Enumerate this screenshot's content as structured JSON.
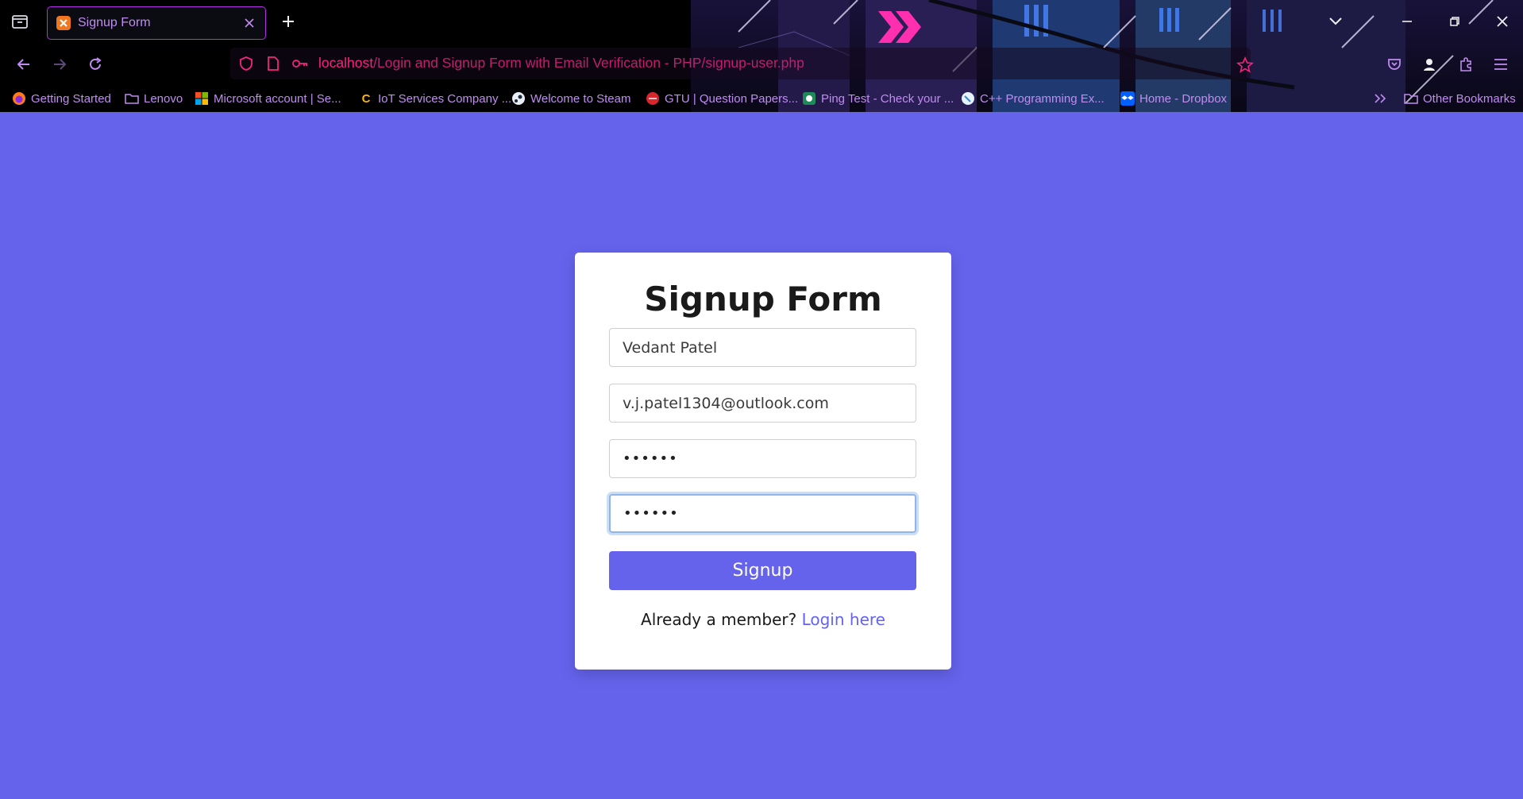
{
  "browser": {
    "tab": {
      "title": "Signup Form",
      "favicon": "xampp-icon"
    },
    "url": {
      "host": "localhost",
      "path": "/Login and Signup Form with Email Verification - PHP/signup-user.php"
    },
    "bookmarks": [
      {
        "label": "Getting Started",
        "icon": "firefox-icon"
      },
      {
        "label": "Lenovo",
        "icon": "folder-icon"
      },
      {
        "label": "Microsoft account | Se...",
        "icon": "microsoft-icon"
      },
      {
        "label": "IoT Services Company ...",
        "icon": "c-logo-icon"
      },
      {
        "label": "Welcome to Steam",
        "icon": "steam-icon"
      },
      {
        "label": "GTU | Question Papers...",
        "icon": "gtu-icon"
      },
      {
        "label": "Ping Test - Check your ...",
        "icon": "ping-icon"
      },
      {
        "label": "C++ Programming Ex...",
        "icon": "cpp-icon"
      },
      {
        "label": "Home - Dropbox",
        "icon": "dropbox-icon"
      }
    ],
    "other_bookmarks": "Other Bookmarks",
    "colors": {
      "accent": "#f5247d",
      "text": "#c08cf0",
      "tab_border": "#b42ee6"
    }
  },
  "page": {
    "background": "#6563ec",
    "title": "Signup Form",
    "fields": {
      "name": "Vedant Patel",
      "email": "v.j.patel1304@outlook.com",
      "password": "••••••",
      "confirm_password": "••••••"
    },
    "submit_label": "Signup",
    "signin_prompt": "Already a member?",
    "signin_link": "Login here"
  }
}
